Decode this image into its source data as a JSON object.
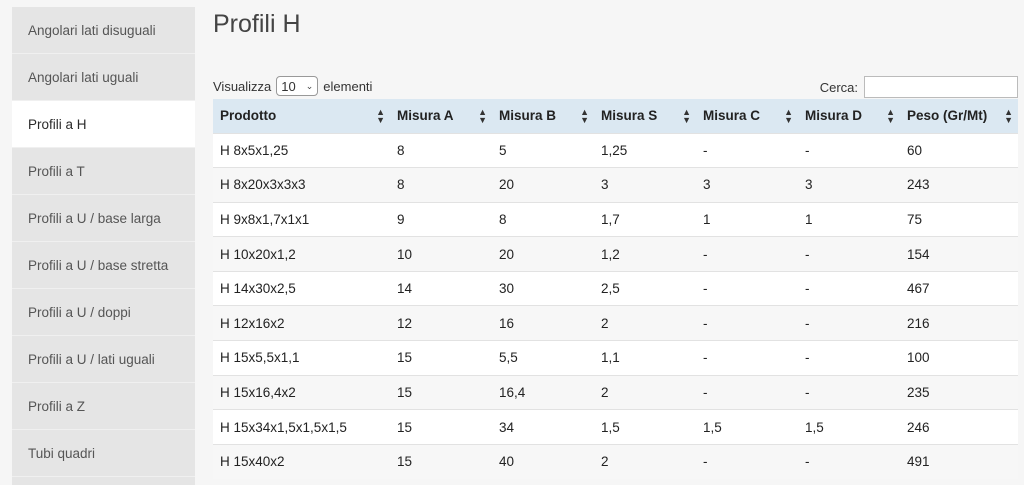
{
  "sidebar": {
    "items": [
      {
        "label": "Angolari lati disuguali",
        "active": false
      },
      {
        "label": "Angolari lati uguali",
        "active": false
      },
      {
        "label": "Profili a H",
        "active": true
      },
      {
        "label": "Profili a T",
        "active": false
      },
      {
        "label": "Profili a U / base larga",
        "active": false
      },
      {
        "label": "Profili a U / base stretta",
        "active": false
      },
      {
        "label": "Profili a U / doppi",
        "active": false
      },
      {
        "label": "Profili a U / lati uguali",
        "active": false
      },
      {
        "label": "Profili a Z",
        "active": false
      },
      {
        "label": "Tubi quadri",
        "active": false
      }
    ]
  },
  "main": {
    "title": "Profili H",
    "length": {
      "prefix": "Visualizza",
      "value": "10",
      "suffix": "elementi"
    },
    "search": {
      "label": "Cerca:",
      "value": ""
    }
  },
  "table": {
    "columns": [
      "Prodotto",
      "Misura A",
      "Misura B",
      "Misura S",
      "Misura C",
      "Misura D",
      "Peso (Gr/Mt)"
    ],
    "rows": [
      [
        "H 8x5x1,25",
        "8",
        "5",
        "1,25",
        "-",
        "-",
        "60"
      ],
      [
        "H 8x20x3x3x3",
        "8",
        "20",
        "3",
        "3",
        "3",
        "243"
      ],
      [
        "H 9x8x1,7x1x1",
        "9",
        "8",
        "1,7",
        "1",
        "1",
        "75"
      ],
      [
        "H 10x20x1,2",
        "10",
        "20",
        "1,2",
        "-",
        "-",
        "154"
      ],
      [
        "H 14x30x2,5",
        "14",
        "30",
        "2,5",
        "-",
        "-",
        "467"
      ],
      [
        "H 12x16x2",
        "12",
        "16",
        "2",
        "-",
        "-",
        "216"
      ],
      [
        "H 15x5,5x1,1",
        "15",
        "5,5",
        "1,1",
        "-",
        "-",
        "100"
      ],
      [
        "H 15x16,4x2",
        "15",
        "16,4",
        "2",
        "-",
        "-",
        "235"
      ],
      [
        "H 15x34x1,5x1,5x1,5",
        "15",
        "34",
        "1,5",
        "1,5",
        "1,5",
        "246"
      ],
      [
        "H 15x40x2",
        "15",
        "40",
        "2",
        "-",
        "-",
        "491"
      ]
    ]
  },
  "icons": {
    "sort": "sort-both-icon",
    "select": "chevron-down-icon"
  }
}
